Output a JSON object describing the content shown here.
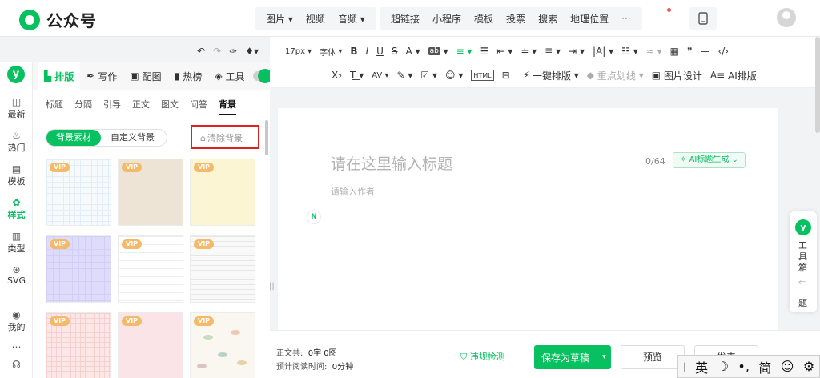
{
  "app": {
    "title": "公众号"
  },
  "insert_menu": {
    "items": [
      "图片",
      "视频",
      "音频",
      "超链接",
      "小程序",
      "模板",
      "投票",
      "搜索",
      "地理位置",
      "···"
    ]
  },
  "sidebar": {
    "items": [
      {
        "label": "最新",
        "icon": "latest-icon"
      },
      {
        "label": "热门",
        "icon": "fire-icon"
      },
      {
        "label": "模板",
        "icon": "template-icon"
      },
      {
        "label": "样式",
        "icon": "style-icon",
        "active": true
      },
      {
        "label": "类型",
        "icon": "type-icon"
      },
      {
        "label": "SVG",
        "icon": "svg-icon"
      },
      {
        "label": "我的",
        "icon": "mine-icon"
      }
    ]
  },
  "panel": {
    "tabs": [
      "排版",
      "写作",
      "配图",
      "热榜",
      "工具"
    ],
    "subtabs": [
      "标题",
      "分隔",
      "引导",
      "正文",
      "图文",
      "问答",
      "背景"
    ],
    "segment": [
      "背景素材",
      "自定义背景"
    ],
    "clear_label": "清除背景",
    "vip_label": "VIP",
    "swatches": [
      "#f7fafd",
      "#eee4d6",
      "#fbf5d3",
      "#dfdcfb",
      "#ffffff",
      "#f9f9f9",
      "#fce6e6",
      "#fbe4e8",
      "#faf7f1"
    ]
  },
  "toolbar": {
    "row1": [
      "17px",
      "字体",
      "B",
      "I",
      "U",
      "S",
      "A",
      "ab",
      "≡",
      "☰",
      "⇤",
      "≑",
      "≣",
      "⇥",
      "|A|",
      "☷",
      "≈",
      "▦",
      "❞",
      "—",
      "‹/›"
    ],
    "row2": [
      "X₂",
      "T͟",
      "AV",
      "✎",
      "☑",
      "☺",
      "HTML",
      "⊟"
    ],
    "one_click_label": "一键排版",
    "highlight_label": "重点划线",
    "image_design_label": "图片设计",
    "ai_layout_label": "AI排版"
  },
  "editor": {
    "title_placeholder": "请在这里输入标题",
    "title_count": "0/64",
    "ai_title_label": "AI标题生成",
    "author_placeholder": "请输入作者"
  },
  "footer": {
    "word_label": "正文共:",
    "word_value": "0字 0图",
    "time_label": "预计阅读时间:",
    "time_value": "0分钟",
    "check_label": "违规检测",
    "save_label": "保存为草稿",
    "preview_label": "预览",
    "publish_label": "发表"
  },
  "helper": {
    "label": "工具箱",
    "extra": "题"
  },
  "ime": {
    "items": [
      "英",
      "☽",
      "•,",
      "简",
      "☺",
      "⚙"
    ]
  },
  "colors": {
    "accent": "#07c160",
    "highlight": "#e02020",
    "vip": "#f5b96a"
  }
}
